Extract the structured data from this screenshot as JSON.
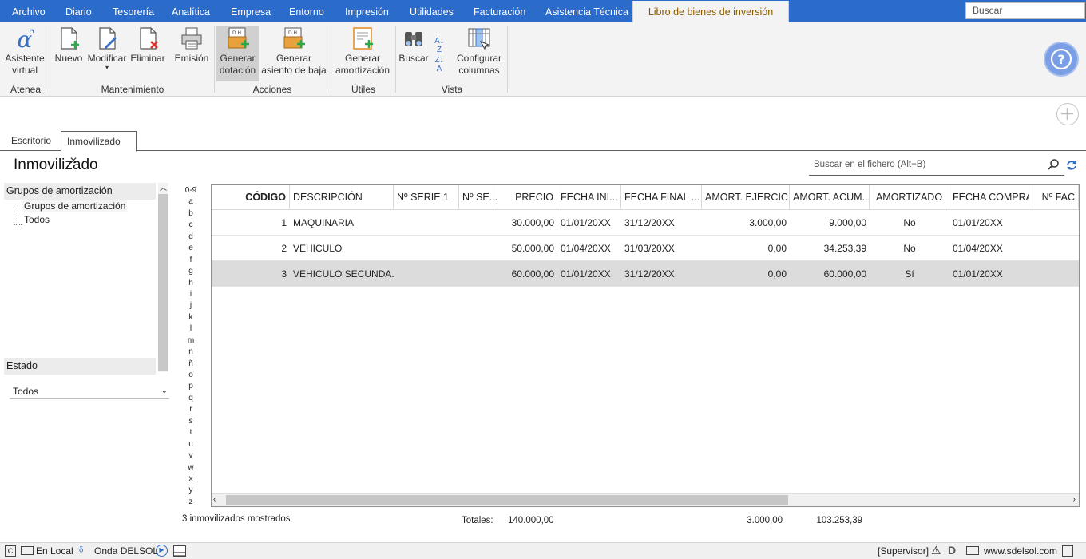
{
  "menu": {
    "items": [
      "Archivo",
      "Diario",
      "Tesorería",
      "Analítica",
      "Empresa",
      "Entorno",
      "Impresión",
      "Utilidades",
      "Facturación",
      "Asistencia Técnica"
    ],
    "active": "Libro de bienes de inversión",
    "search_placeholder": "Buscar"
  },
  "ribbon": {
    "asistente": [
      "Asistente",
      "virtual"
    ],
    "nuevo": "Nuevo",
    "modificar": "Modificar",
    "eliminar": "Eliminar",
    "emision": "Emisión",
    "generar_dotacion": [
      "Generar",
      "dotación"
    ],
    "generar_baja": [
      "Generar",
      "asiento de baja"
    ],
    "generar_amortizacion": [
      "Generar",
      "amortización"
    ],
    "buscar": "Buscar",
    "configurar": [
      "Configurar",
      "columnas"
    ],
    "groups": {
      "atenea": "Atenea",
      "mantenimiento": "Mantenimiento",
      "acciones": "Acciones",
      "utiles": "Útiles",
      "vista": "Vista"
    }
  },
  "tabs": [
    "Escritorio",
    "Inmovilizado"
  ],
  "page": {
    "title": "Inmovilizado",
    "search_placeholder": "Buscar en el fichero (Alt+B)"
  },
  "left": {
    "groups_header": "Grupos de amortización",
    "tree": [
      "Grupos de amortización",
      "Todos"
    ],
    "estado_header": "Estado",
    "estado_value": "Todos"
  },
  "alpha_index": [
    "0-9",
    "a",
    "b",
    "c",
    "d",
    "e",
    "f",
    "g",
    "h",
    "i",
    "j",
    "k",
    "l",
    "m",
    "n",
    "ñ",
    "o",
    "p",
    "q",
    "r",
    "s",
    "t",
    "u",
    "v",
    "w",
    "x",
    "y",
    "z"
  ],
  "table": {
    "columns": [
      "CÓDIGO",
      "DESCRIPCIÓN",
      "Nº SERIE 1",
      "Nº SE...",
      "PRECIO",
      "FECHA INI...",
      "FECHA FINAL ...",
      "AMORT. EJERCICIO",
      "AMORT. ACUM...",
      "AMORTIZADO",
      "FECHA COMPRA",
      "Nº FAC"
    ],
    "rows": [
      [
        "1",
        "MAQUINARIA",
        "",
        "",
        "30.000,00",
        "01/01/20XX",
        "31/12/20XX",
        "3.000,00",
        "9.000,00",
        "No",
        "01/01/20XX",
        ""
      ],
      [
        "2",
        "VEHICULO",
        "",
        "",
        "50.000,00",
        "01/04/20XX",
        "31/03/20XX",
        "0,00",
        "34.253,39",
        "No",
        "01/04/20XX",
        ""
      ],
      [
        "3",
        "VEHICULO SECUNDA...",
        "",
        "",
        "60.000,00",
        "01/01/20XX",
        "31/12/20XX",
        "0,00",
        "60.000,00",
        "Sí",
        "01/01/20XX",
        ""
      ]
    ],
    "selected_row": 2
  },
  "footer": {
    "count": "3 inmovilizados mostrados",
    "totals_label": "Totales:",
    "precio_total": "140.000,00",
    "amort_ejercicio_total": "3.000,00",
    "amort_acum_total": "103.253,39"
  },
  "status": {
    "local": "En Local",
    "onda": "Onda DELSOL",
    "user": "[Supervisor]",
    "web": "www.sdelsol.com"
  }
}
